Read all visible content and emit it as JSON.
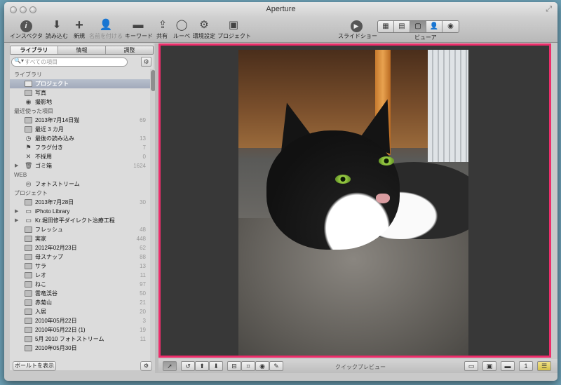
{
  "window": {
    "title": "Aperture"
  },
  "toolbar": {
    "items": [
      {
        "label": "インスペクタ",
        "icon": "info-icon"
      },
      {
        "label": "読み込む",
        "icon": "import-arrow-icon"
      },
      {
        "label": "新規",
        "icon": "plus-icon"
      },
      {
        "label": "名前を付ける",
        "icon": "person-icon"
      },
      {
        "label": "キーワード",
        "icon": "tag-icon"
      },
      {
        "label": "共有",
        "icon": "share-icon"
      },
      {
        "label": "ルーペ",
        "icon": "loupe-icon"
      },
      {
        "label": "環境設定",
        "icon": "preferences-icon"
      },
      {
        "label": "プロジェクト",
        "icon": "project-box-icon"
      },
      {
        "label": "スライドショー",
        "icon": "play-icon"
      }
    ],
    "viewer_label": "ビューア"
  },
  "sidebar": {
    "tabs": [
      "ライブラリ",
      "情報",
      "調整"
    ],
    "search_placeholder": "すべての項目",
    "sections": {
      "library": "ライブラリ",
      "recent": "最近使った項目",
      "web": "WEB",
      "projects": "プロジェクト"
    },
    "library_items": [
      {
        "label": "プロジェクト",
        "selected": true
      },
      {
        "label": "写真"
      },
      {
        "label": "撮影地"
      }
    ],
    "recent_items": [
      {
        "label": "2013年7月14日猫",
        "count": "69"
      },
      {
        "label": "最近 3 カ月",
        "count": ""
      },
      {
        "label": "最後の読み込み",
        "count": "13"
      },
      {
        "label": "フラグ付き",
        "count": "7"
      },
      {
        "label": "不採用",
        "count": "0"
      },
      {
        "label": "ゴミ箱",
        "count": "1624"
      }
    ],
    "web_items": [
      {
        "label": "フォトストリーム"
      }
    ],
    "project_items": [
      {
        "label": "2013年7月28日",
        "count": "30"
      },
      {
        "label": "iPhoto Library",
        "count": ""
      },
      {
        "label": "Kr.堀田修平ダイレクト治療工程",
        "count": ""
      },
      {
        "label": "フレッシュ",
        "count": "48"
      },
      {
        "label": "実家",
        "count": "448"
      },
      {
        "label": "2012年02月23日",
        "count": "62"
      },
      {
        "label": "母スナップ",
        "count": "88"
      },
      {
        "label": "サラ",
        "count": "13"
      },
      {
        "label": "レオ",
        "count": "11"
      },
      {
        "label": "ねこ",
        "count": "97"
      },
      {
        "label": "雲竜渓谷",
        "count": "50"
      },
      {
        "label": "赤菊山",
        "count": "21"
      },
      {
        "label": "入居",
        "count": "20"
      },
      {
        "label": "2010年05月22日",
        "count": "3"
      },
      {
        "label": "2010年05月22日 (1)",
        "count": "19"
      },
      {
        "label": "5月 2010 フォトストリーム",
        "count": "11"
      },
      {
        "label": "2010年05月30日",
        "count": ""
      }
    ],
    "show_vault_button": "ボールトを表示"
  },
  "bottom_bar": {
    "quick_preview_label": "クイックプレビュー"
  },
  "colors": {
    "viewer_border": "#ee2d6b",
    "viewer_background": "#383838"
  }
}
